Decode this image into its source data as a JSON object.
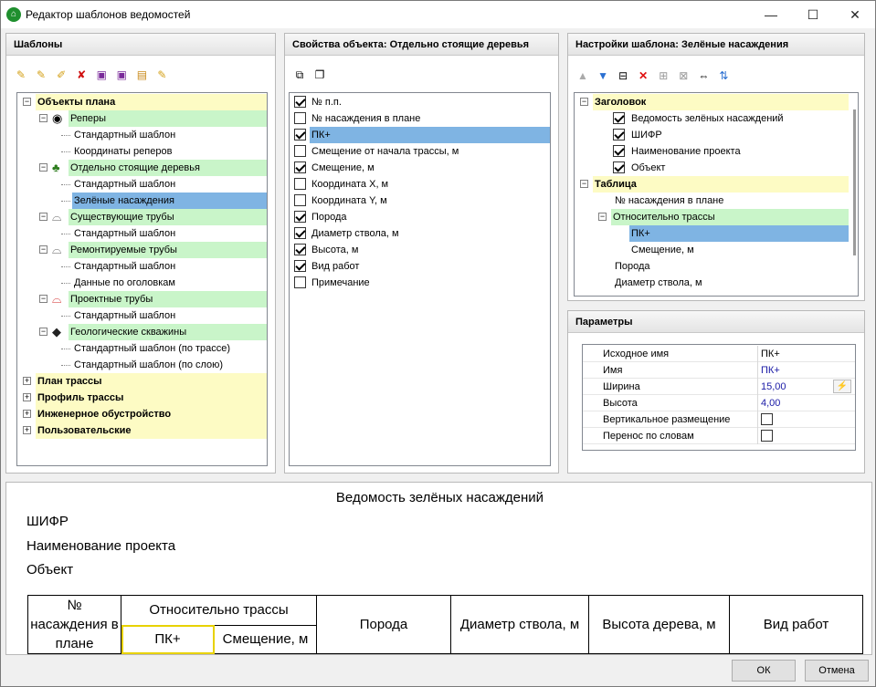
{
  "window": {
    "title": "Редактор шаблонов ведомостей",
    "minimize": "—",
    "maximize": "☐",
    "close": "✕"
  },
  "templates": {
    "header": "Шаблоны",
    "tree": [
      {
        "label": "Объекты плана",
        "level": 0,
        "style": "yel",
        "exp": "−"
      },
      {
        "label": "Реперы",
        "level": 1,
        "style": "grn",
        "exp": "−",
        "icon": "benchmark-icon"
      },
      {
        "label": "Стандартный шаблон",
        "level": 2
      },
      {
        "label": "Координаты реперов",
        "level": 2
      },
      {
        "label": "Отдельно стоящие деревья",
        "level": 1,
        "style": "grn",
        "exp": "−",
        "icon": "tree-icon"
      },
      {
        "label": "Стандартный шаблон",
        "level": 2
      },
      {
        "label": "Зелёные насаждения",
        "level": 2,
        "style": "sel"
      },
      {
        "label": "Существующие трубы",
        "level": 1,
        "style": "grn",
        "exp": "−",
        "icon": "pipe-icon"
      },
      {
        "label": "Стандартный шаблон",
        "level": 2
      },
      {
        "label": "Ремонтируемые трубы",
        "level": 1,
        "style": "grn",
        "exp": "−",
        "icon": "pipe-icon"
      },
      {
        "label": "Стандартный шаблон",
        "level": 2
      },
      {
        "label": "Данные по оголовкам",
        "level": 2
      },
      {
        "label": "Проектные трубы",
        "level": 1,
        "style": "grn",
        "exp": "−",
        "icon": "pipe-red-icon"
      },
      {
        "label": "Стандартный шаблон",
        "level": 2
      },
      {
        "label": "Геологические скважины",
        "level": 1,
        "style": "grn",
        "exp": "−",
        "icon": "diamond-icon"
      },
      {
        "label": "Стандартный шаблон (по трассе)",
        "level": 2
      },
      {
        "label": "Стандартный шаблон (по слою)",
        "level": 2
      },
      {
        "label": "План трассы",
        "level": 0,
        "style": "yel",
        "exp": "+"
      },
      {
        "label": "Профиль трассы",
        "level": 0,
        "style": "yel",
        "exp": "+"
      },
      {
        "label": "Инженерное обустройство",
        "level": 0,
        "style": "yel",
        "exp": "+"
      },
      {
        "label": "Пользовательские",
        "level": 0,
        "style": "yel",
        "exp": "+"
      }
    ]
  },
  "props": {
    "header": "Свойства объекта: Отдельно стоящие деревья",
    "items": [
      {
        "label": "№ п.п.",
        "checked": true
      },
      {
        "label": "№ насаждения в плане",
        "checked": false
      },
      {
        "label": "ПК+",
        "checked": true,
        "selected": true
      },
      {
        "label": "Смещение от начала трассы, м",
        "checked": false
      },
      {
        "label": "Смещение, м",
        "checked": true
      },
      {
        "label": "Координата X, м",
        "checked": false
      },
      {
        "label": "Координата Y, м",
        "checked": false
      },
      {
        "label": "Порода",
        "checked": true
      },
      {
        "label": "Диаметр ствола, м",
        "checked": true
      },
      {
        "label": "Высота, м",
        "checked": true
      },
      {
        "label": "Вид работ",
        "checked": true
      },
      {
        "label": "Примечание",
        "checked": false
      }
    ]
  },
  "settings": {
    "header": "Настройки шаблона: Зелёные насаждения",
    "tree": [
      {
        "label": "Заголовок",
        "level": 0,
        "style": "yel",
        "exp": "−"
      },
      {
        "label": "Ведомость зелёных насаждений",
        "level": 1,
        "cb": true
      },
      {
        "label": "ШИФР",
        "level": 1,
        "cb": true
      },
      {
        "label": "Наименование проекта",
        "level": 1,
        "cb": true
      },
      {
        "label": "Объект",
        "level": 1,
        "cb": true
      },
      {
        "label": "Таблица",
        "level": 0,
        "style": "yel",
        "exp": "−"
      },
      {
        "label": "№ насаждения в плане",
        "level": 1
      },
      {
        "label": "Относительно трассы",
        "level": 1,
        "style": "grn",
        "exp": "−"
      },
      {
        "label": "ПК+",
        "level": 2,
        "style": "sel"
      },
      {
        "label": "Смещение, м",
        "level": 2
      },
      {
        "label": "Порода",
        "level": 1
      },
      {
        "label": "Диаметр ствола, м",
        "level": 1
      }
    ]
  },
  "params": {
    "header": "Параметры",
    "rows": [
      {
        "name": "Исходное имя",
        "value": "ПК+",
        "blue": false
      },
      {
        "name": "Имя",
        "value": "ПК+",
        "blue": true
      },
      {
        "name": "Ширина",
        "value": "15,00",
        "blue": true,
        "btn": true
      },
      {
        "name": "Высота",
        "value": "4,00",
        "blue": true
      },
      {
        "name": "Вертикальное размещение",
        "value": "",
        "cb": true
      },
      {
        "name": "Перенос по словам",
        "value": "",
        "cb": true
      }
    ]
  },
  "preview": {
    "title": "Ведомость зелёных насаждений",
    "line1": "ШИФР",
    "line2": "Наименование проекта",
    "line3": "Объект",
    "col_no": "№ насаждения в плане",
    "col_group": "Относительно трассы",
    "col_pk": "ПК+",
    "col_offset": "Смещение, м",
    "col_breed": "Порода",
    "col_diam": "Диаметр ствола, м",
    "col_height": "Высота дерева, м",
    "col_work": "Вид работ"
  },
  "buttons": {
    "ok": "ОК",
    "cancel": "Отмена"
  }
}
